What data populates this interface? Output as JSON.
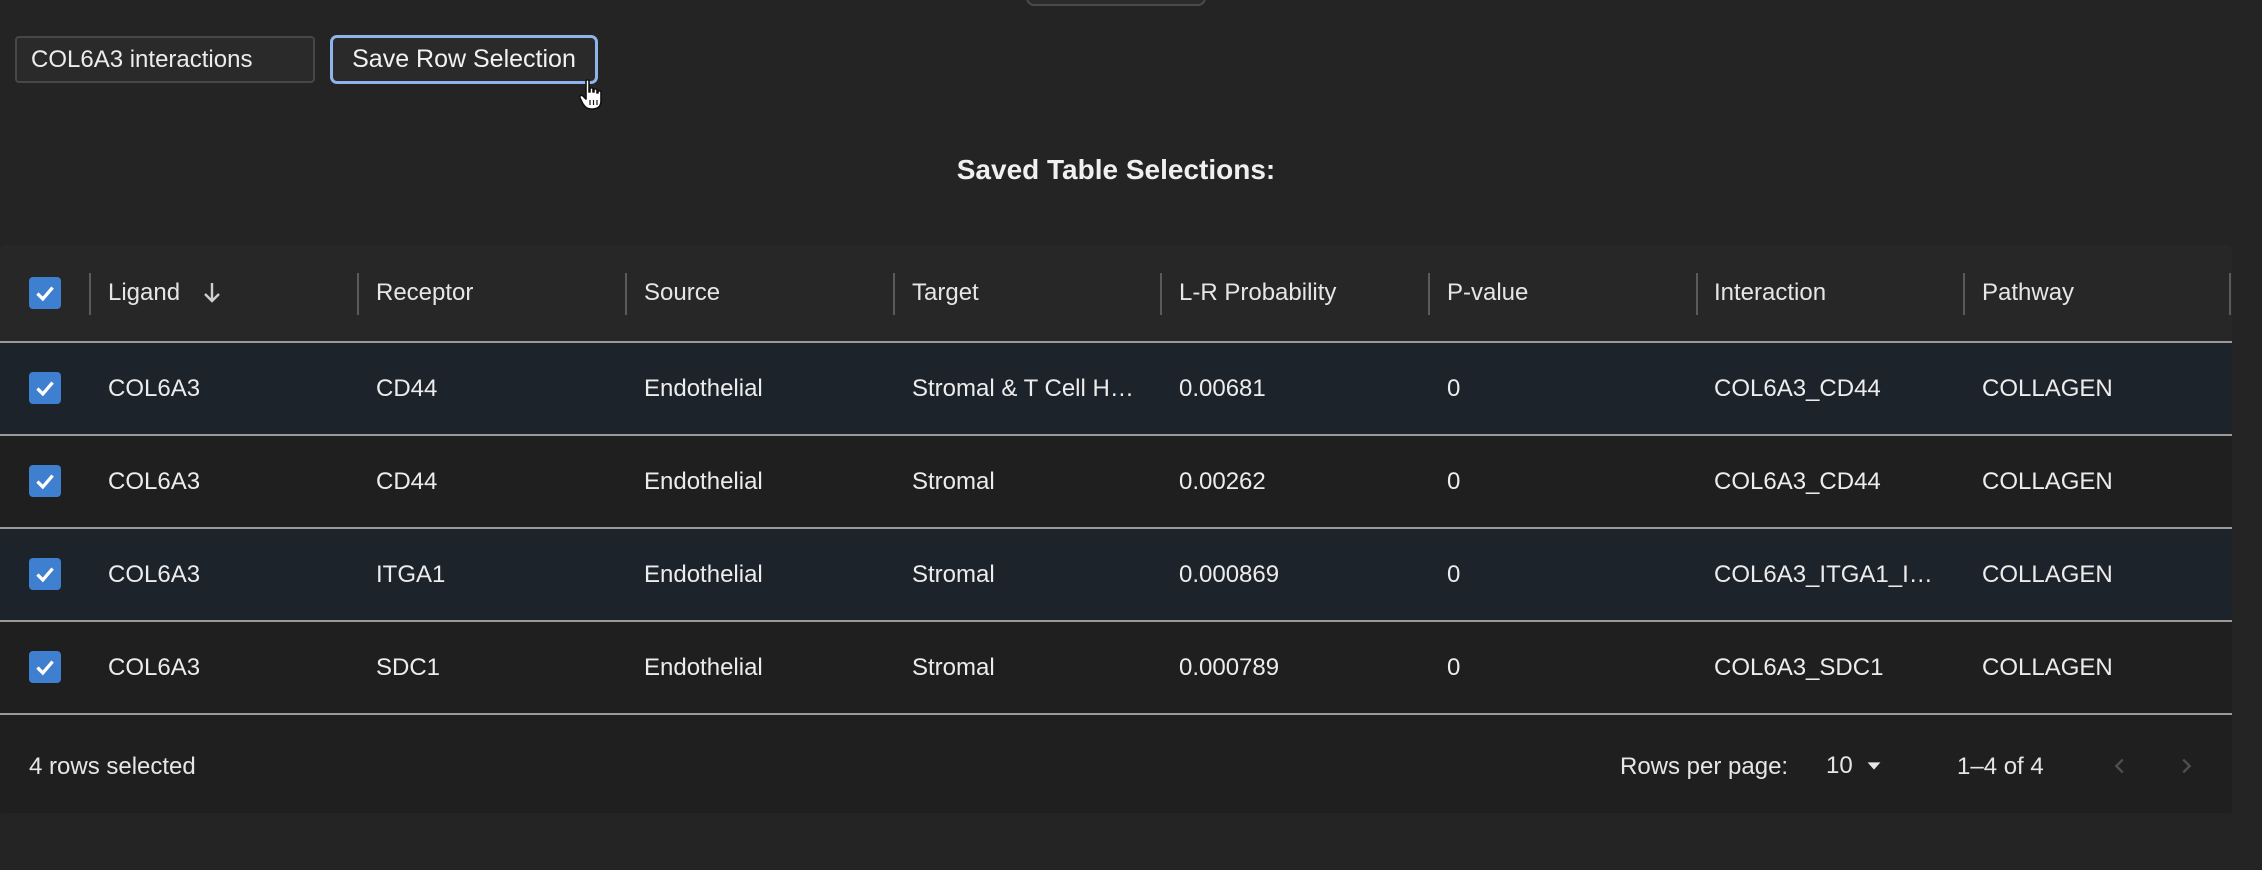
{
  "toolbar": {
    "selection_name_value": "COL6A3 interactions",
    "save_label": "Save Row Selection"
  },
  "saved": {
    "title": "Saved Table Selections:"
  },
  "table": {
    "columns": [
      {
        "label": "Ligand",
        "sorted": "descending"
      },
      {
        "label": "Receptor"
      },
      {
        "label": "Source"
      },
      {
        "label": "Target"
      },
      {
        "label": "L-R Probability"
      },
      {
        "label": "P-value"
      },
      {
        "label": "Interaction"
      },
      {
        "label": "Pathway"
      }
    ],
    "rows": [
      {
        "checked": true,
        "cells": [
          "COL6A3",
          "CD44",
          "Endothelial",
          "Stromal & T Cell H…",
          "0.00681",
          "0",
          "COL6A3_CD44",
          "COLLAGEN"
        ]
      },
      {
        "checked": true,
        "cells": [
          "COL6A3",
          "CD44",
          "Endothelial",
          "Stromal",
          "0.00262",
          "0",
          "COL6A3_CD44",
          "COLLAGEN"
        ]
      },
      {
        "checked": true,
        "cells": [
          "COL6A3",
          "ITGA1",
          "Endothelial",
          "Stromal",
          "0.000869",
          "0",
          "COL6A3_ITGA1_I…",
          "COLLAGEN"
        ]
      },
      {
        "checked": true,
        "cells": [
          "COL6A3",
          "SDC1",
          "Endothelial",
          "Stromal",
          "0.000789",
          "0",
          "COL6A3_SDC1",
          "COLLAGEN"
        ]
      }
    ]
  },
  "footer": {
    "selected_text": "4 rows selected",
    "rows_per_page_label": "Rows per page:",
    "rows_per_page_value": "10",
    "range_text": "1–4 of 4"
  },
  "colors": {
    "accent": "#3f7fd0",
    "button_focus_border": "#8fb4ec",
    "background": "#242424",
    "row_highlight": "#1d232b"
  },
  "icons": [
    "check-icon",
    "arrow-down-icon",
    "caret-down-icon",
    "chevron-left-icon",
    "chevron-right-icon",
    "hand-cursor-icon"
  ]
}
